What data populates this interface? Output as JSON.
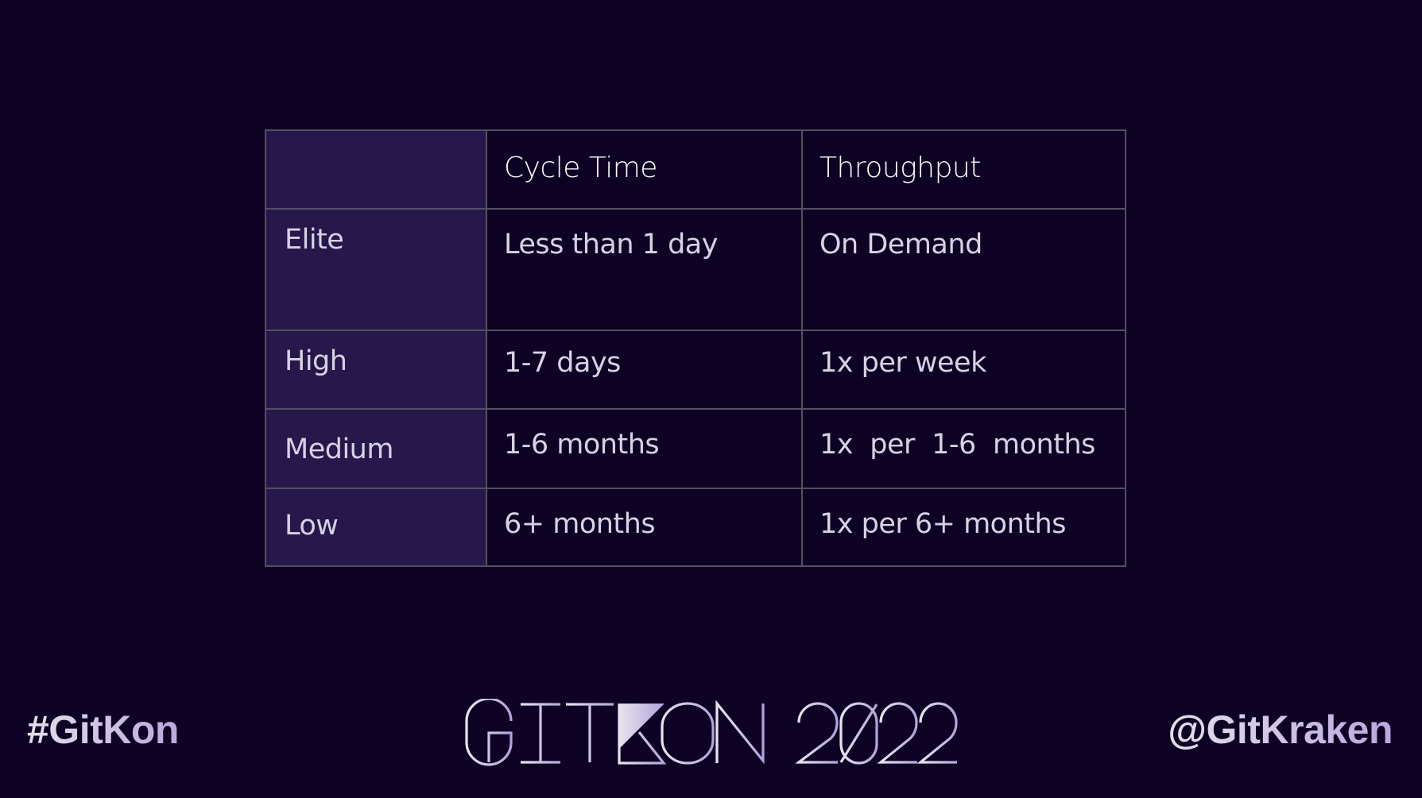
{
  "table": {
    "header": {
      "corner": "",
      "columns": [
        "Cycle Time",
        "Throughput"
      ]
    },
    "rows": [
      {
        "label": "Elite",
        "cycle_time": "Less than 1 day",
        "throughput": "On Demand"
      },
      {
        "label": "High",
        "cycle_time": "1-7 days",
        "throughput": "1x per week"
      },
      {
        "label": "Medium",
        "cycle_time": "1-6 months",
        "throughput": "1x  per  1-6  months"
      },
      {
        "label": "Low",
        "cycle_time": "6+ months",
        "throughput": "1x per 6+ months"
      }
    ]
  },
  "footer": {
    "hashtag": "#GitKon",
    "logo_text": "GITKON 2022",
    "handle": "@GitKraken"
  },
  "colors": {
    "background": "#0d0224",
    "label_column": "#26184a",
    "border": "#55505e",
    "accent_lavender": "#b6a6dc"
  }
}
